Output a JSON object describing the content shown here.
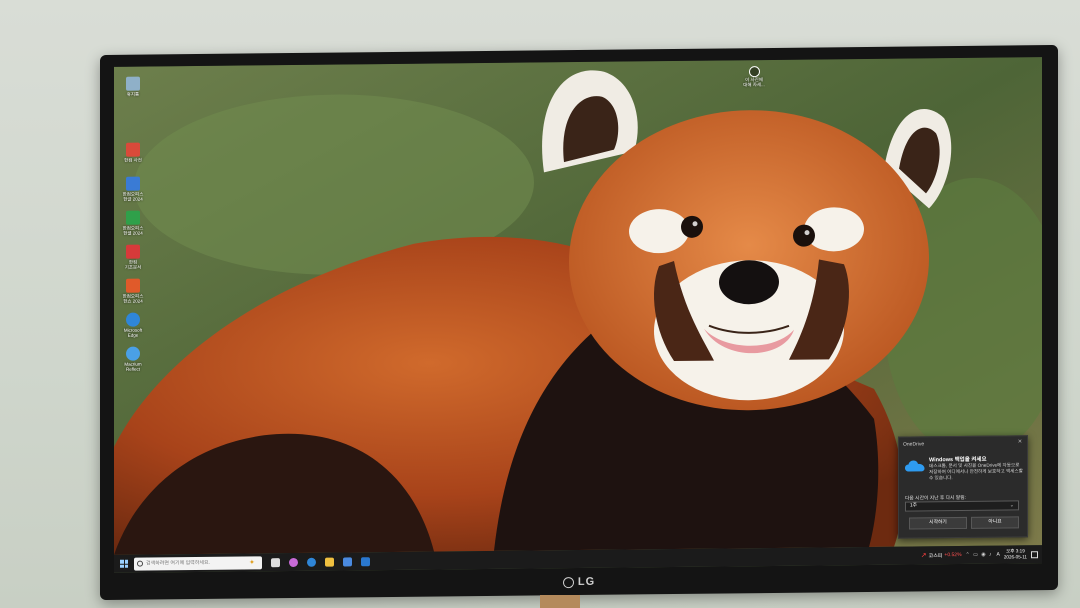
{
  "monitor": {
    "brand": "LG"
  },
  "desktop": {
    "icons": [
      {
        "name": "recycle-bin",
        "label": "휴지통",
        "color": "#8fb0c8"
      },
      {
        "name": "hancom",
        "label": "한컴 사전",
        "color": "#d94a3a"
      },
      {
        "name": "hwp",
        "label": "한컴오피스\n한글 2024",
        "color": "#3a7bd5"
      },
      {
        "name": "hcell",
        "label": "한컴오피스\n한셀 2024",
        "color": "#2fa04a"
      },
      {
        "name": "hancom-viewer",
        "label": "한컴\n기초문서",
        "color": "#d63a3a"
      },
      {
        "name": "hshow",
        "label": "한컴오피스\n한쇼 2024",
        "color": "#e05a2a"
      },
      {
        "name": "edge",
        "label": "Microsoft\nEdge",
        "color": "#2f86d8"
      },
      {
        "name": "macrium",
        "label": "Macrium\nReflect",
        "color": "#4aa0e6"
      }
    ],
    "user_widget": {
      "label": "이 사진에\n대해 자세..."
    }
  },
  "onedrive_popup": {
    "header": "OneDrive",
    "title": "Windows 백업을 켜세요",
    "body": "데스크톱, 문서 및 사진을 OneDrive에 자동으로 저장하여 어디에서나 안전하게 보호하고 액세스할 수 있습니다.",
    "question": "다음 시간이 지난 후 다시 알림:",
    "select_value": "1주",
    "start_label": "시작하기",
    "no_label": "아니요"
  },
  "taskbar": {
    "search_placeholder": "검색하려면 여기에 입력하세요.",
    "stock_name": "코스피",
    "stock_change": "+0.52%",
    "ime": "A",
    "time": "오후 3:19",
    "date": "2026-05-11",
    "pinned": [
      {
        "name": "task-view",
        "color": "#dddddd"
      },
      {
        "name": "copilot",
        "color": "#c86ad8"
      },
      {
        "name": "edge",
        "color": "#2f86d8"
      },
      {
        "name": "file-explorer",
        "color": "#f0c040"
      },
      {
        "name": "store",
        "color": "#4a8ae0"
      },
      {
        "name": "outlook",
        "color": "#2a78d0"
      }
    ]
  }
}
